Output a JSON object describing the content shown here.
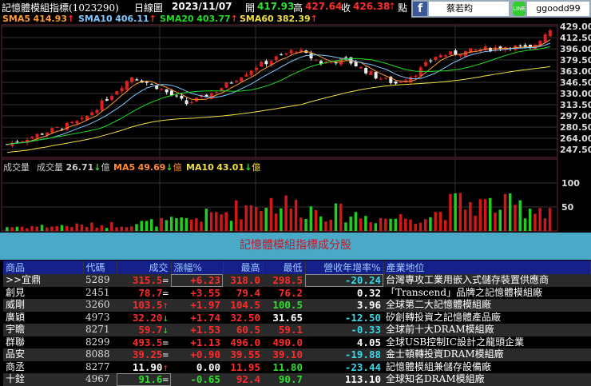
{
  "header": {
    "title": "記憶體模組指標(1023290)",
    "period": "日線圖",
    "date": "2023/11/07",
    "open_label": "開",
    "open": "417.93",
    "high_label": "高",
    "high": "427.64",
    "close_label": "收",
    "close": "426.38",
    "close_arrow": "↑",
    "unit": "點"
  },
  "social": {
    "fb_icon": "f",
    "fb_name": "蔡若昀",
    "line_icon": "LINE",
    "line_id": "ggoodd99"
  },
  "sma": [
    {
      "label": "SMA5",
      "value": "414.93",
      "arrow": "↑",
      "color": "#ff9a2e"
    },
    {
      "label": "SMA10",
      "value": "406.11",
      "arrow": "↑",
      "color": "#7ec8ff"
    },
    {
      "label": "SMA20",
      "value": "403.77",
      "arrow": "↑",
      "color": "#22dd22"
    },
    {
      "label": "SMA60",
      "value": "382.39",
      "arrow": "↑",
      "color": "#f0e040"
    }
  ],
  "volume": {
    "label": "成交量",
    "vol_label": "成交量",
    "vol": "26.71",
    "vol_arrow": "↓",
    "vol_unit": "億",
    "ma5_label": "MA5",
    "ma5": "49.69",
    "ma5_arrow": "↓",
    "ma5_unit": "億",
    "ma10_label": "MA10",
    "ma10": "43.01",
    "ma10_arrow": "↓",
    "ma10_unit": "億"
  },
  "chart_data": {
    "type": "candlestick",
    "price_axis": [
      "429.00",
      "412.50",
      "396.00",
      "379.50",
      "363.00",
      "346.50",
      "330.00",
      "313.50",
      "297.00",
      "280.50",
      "264.00",
      "247.50"
    ],
    "ylim": [
      247.5,
      429
    ],
    "volume_axis": [
      "100",
      "50"
    ],
    "close_keypoints": [
      [
        0,
        255
      ],
      [
        15,
        290
      ],
      [
        25,
        355
      ],
      [
        30,
        340
      ],
      [
        36,
        315
      ],
      [
        41,
        330
      ],
      [
        50,
        370
      ],
      [
        58,
        395
      ],
      [
        63,
        375
      ],
      [
        68,
        380
      ],
      [
        74,
        355
      ],
      [
        78,
        345
      ],
      [
        82,
        360
      ],
      [
        86,
        385
      ],
      [
        95,
        395
      ],
      [
        101,
        400
      ],
      [
        105,
        395
      ],
      [
        109,
        426
      ]
    ],
    "volume_keypoints": [
      [
        0,
        8
      ],
      [
        20,
        12
      ],
      [
        35,
        20
      ],
      [
        45,
        40
      ],
      [
        52,
        60
      ],
      [
        60,
        45
      ],
      [
        75,
        25
      ],
      [
        85,
        30
      ],
      [
        90,
        55
      ],
      [
        100,
        50
      ],
      [
        109,
        45
      ]
    ]
  },
  "table": {
    "title": "記憶體模組指標成分股",
    "headers": [
      "商品",
      "代碼",
      "成交",
      "漲幅%",
      "最高",
      "最低",
      "營收年增率%",
      "產業地位"
    ],
    "rows": [
      {
        "name": ">>宜鼎",
        "code": "5289",
        "price": "315.5",
        "mark": "=",
        "pc": "r",
        "chg": "+6.23",
        "cc": "r",
        "high": "318.0",
        "hc": "r",
        "low": "298.5",
        "lc": "r",
        "rev": "-20.24",
        "rc": "c",
        "ind": "台灣專攻工業用嵌入式儲存裝置供應商"
      },
      {
        "name": "創見",
        "code": "2451",
        "price": "78.7",
        "mark": "=",
        "pc": "r",
        "chg": "+3.55",
        "cc": "r",
        "high": "79.4",
        "hc": "r",
        "low": "76.2",
        "lc": "r",
        "rev": "0.32",
        "rc": "w",
        "ind": "「Transcend」品牌之記憶體模組廠"
      },
      {
        "name": "威剛",
        "code": "3260",
        "price": "103.5",
        "mark": "↑",
        "pc": "r",
        "chg": "+1.97",
        "cc": "r",
        "high": "104.5",
        "hc": "r",
        "low": "100.5",
        "lc": "g",
        "rev": "3.96",
        "rc": "w",
        "ind": "全球第二大記憶體模組廠"
      },
      {
        "name": "廣穎",
        "code": "4973",
        "price": "32.20",
        "mark": "↓",
        "pc": "r",
        "chg": "+1.74",
        "cc": "r",
        "high": "32.50",
        "hc": "r",
        "low": "31.65",
        "lc": "w",
        "rev": "-12.50",
        "rc": "c",
        "ind": "矽創轉投資之記憶體產品廠"
      },
      {
        "name": "宇瞻",
        "code": "8271",
        "price": "59.7",
        "mark": "↓",
        "pc": "r",
        "chg": "+1.53",
        "cc": "r",
        "high": "60.5",
        "hc": "r",
        "low": "59.1",
        "lc": "r",
        "rev": "-0.33",
        "rc": "c",
        "ind": "全球前十大DRAM模組廠"
      },
      {
        "name": "群聯",
        "code": "8299",
        "price": "493.5",
        "mark": "=",
        "pc": "r",
        "chg": "+1.13",
        "cc": "r",
        "high": "496.0",
        "hc": "r",
        "low": "490.0",
        "lc": "r",
        "rev": "4.05",
        "rc": "w",
        "ind": "全球USB控制IC設計之龍頭企業"
      },
      {
        "name": "品安",
        "code": "8088",
        "price": "39.25",
        "mark": "=",
        "pc": "r",
        "chg": "+0.90",
        "cc": "r",
        "high": "39.55",
        "hc": "r",
        "low": "39.10",
        "lc": "r",
        "rev": "-19.88",
        "rc": "c",
        "ind": "金士頓轉投資DRAM模組廠"
      },
      {
        "name": "商丞",
        "code": "8277",
        "price": "11.90",
        "mark": "↑",
        "pc": "w",
        "chg": "0.00",
        "cc": "w",
        "high": "11.95",
        "hc": "r",
        "low": "11.80",
        "lc": "g",
        "rev": "-23.44",
        "rc": "c",
        "ind": "記憶體模組兼儲存設備廠"
      },
      {
        "name": "十銓",
        "code": "4967",
        "price": "91.6",
        "mark": "=",
        "pc": "g",
        "chg": "-0.65",
        "cc": "g",
        "high": "92.4",
        "hc": "r",
        "low": "90.7",
        "lc": "g",
        "rev": "113.10",
        "rc": "w",
        "ind": "全球知名DRAM模組廠"
      }
    ]
  }
}
